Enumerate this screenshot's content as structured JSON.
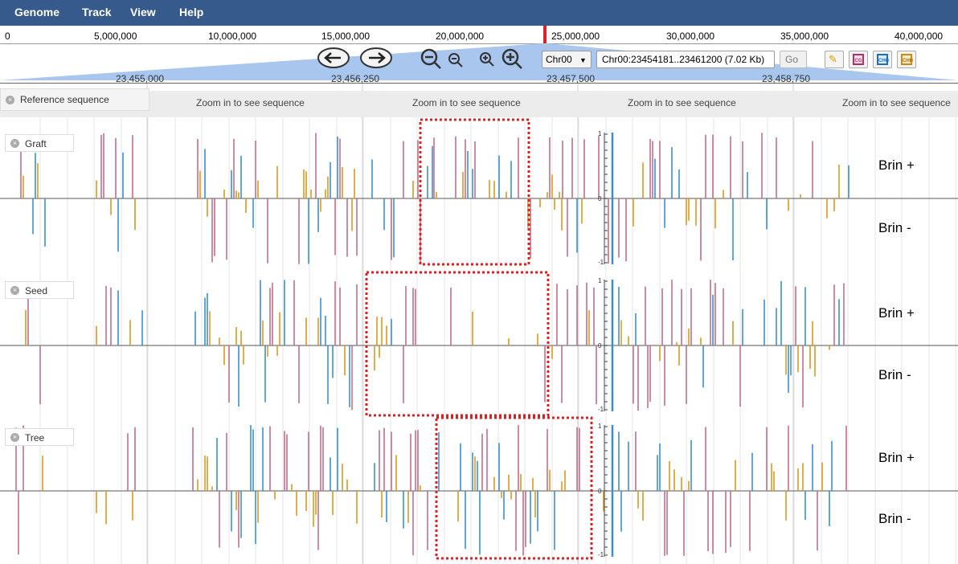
{
  "menu": {
    "items": [
      "Genome",
      "Track",
      "View",
      "Help"
    ]
  },
  "overview": {
    "labels": [
      "0",
      "5,000,000",
      "10,000,000",
      "15,000,000",
      "20,000,000",
      "25,000,000",
      "30,000,000",
      "35,000,000",
      "40,000,000"
    ]
  },
  "nav": {
    "chrom": "Chr00",
    "location": "Chr00:23454181..23461200 (7.02 Kb)",
    "go_label": "Go",
    "buttons": [
      "highlight-icon",
      "CG",
      "CHG",
      "CHH"
    ]
  },
  "ruler": {
    "labels": [
      "23,455,000",
      "23,456,250",
      "23,457,500",
      "23,458,750"
    ]
  },
  "reference": {
    "label": "Reference sequence",
    "zoom_text": "Zoom in to see sequence"
  },
  "tracks": [
    {
      "name": "Graft",
      "plus": "Brin +",
      "minus": "Brin -",
      "axis": {
        "top": "1",
        "mid": "0",
        "bottom": "-1"
      }
    },
    {
      "name": "Seed",
      "plus": "Brin +",
      "minus": "Brin -",
      "axis": {
        "top": "1",
        "mid": "0",
        "bottom": "-1"
      }
    },
    {
      "name": "Tree",
      "plus": "Brin +",
      "minus": "Brin -",
      "axis": {
        "top": "1",
        "mid": "0",
        "bottom": "-1"
      }
    }
  ],
  "colors": {
    "menubar": "#355a8b",
    "cg": "#c0708a",
    "chg": "#3a8fd0",
    "chh": "#d99a1e",
    "highlight": "#e02020"
  }
}
